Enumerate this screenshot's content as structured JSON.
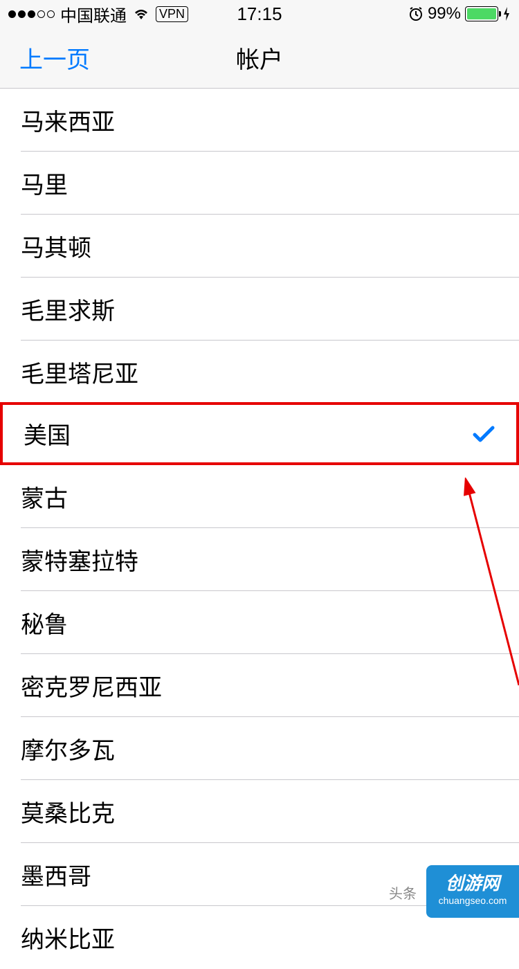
{
  "status_bar": {
    "carrier": "中国联通",
    "vpn": "VPN",
    "time": "17:15",
    "battery_pct": "99%"
  },
  "nav": {
    "back_label": "上一页",
    "title": "帐户"
  },
  "countries": [
    {
      "label": "马来西亚",
      "selected": false
    },
    {
      "label": "马里",
      "selected": false
    },
    {
      "label": "马其顿",
      "selected": false
    },
    {
      "label": "毛里求斯",
      "selected": false
    },
    {
      "label": "毛里塔尼亚",
      "selected": false
    },
    {
      "label": "美国",
      "selected": true,
      "highlighted": true
    },
    {
      "label": "蒙古",
      "selected": false
    },
    {
      "label": "蒙特塞拉特",
      "selected": false
    },
    {
      "label": "秘鲁",
      "selected": false
    },
    {
      "label": "密克罗尼西亚",
      "selected": false
    },
    {
      "label": "摩尔多瓦",
      "selected": false
    },
    {
      "label": "莫桑比克",
      "selected": false
    },
    {
      "label": "墨西哥",
      "selected": false
    },
    {
      "label": "纳米比亚",
      "selected": false
    }
  ],
  "watermark": {
    "line1": "创游网",
    "line2": "chuangseo.com",
    "source": "头条"
  }
}
